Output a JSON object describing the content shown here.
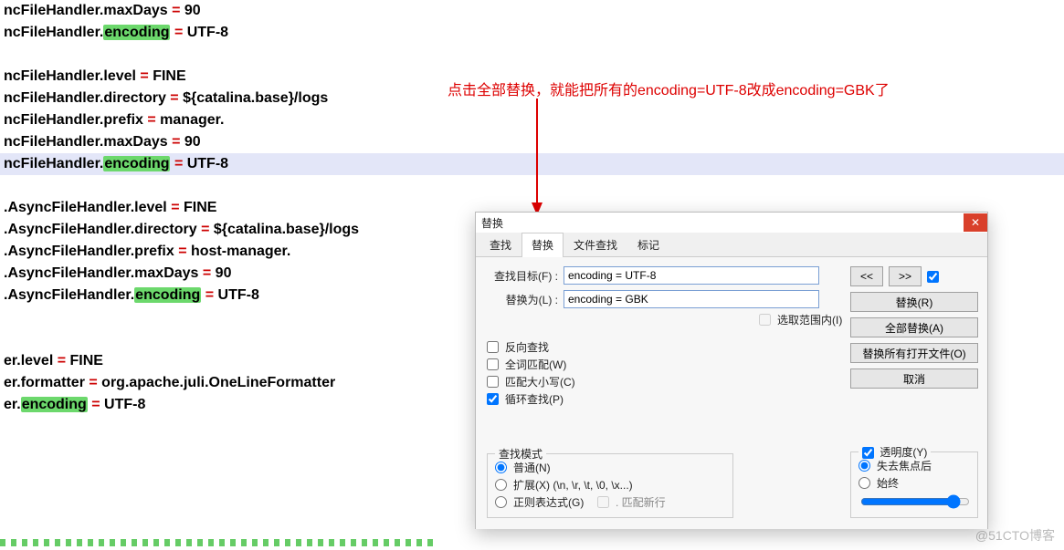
{
  "annotation": "点击全部替换，就能把所有的encoding=UTF-8改成encoding=GBK了",
  "watermark": "@51CTO博客",
  "editor": {
    "lines": [
      {
        "group": 0,
        "prefix": "ncFileHandler.",
        "key": "maxDays",
        "val": "90"
      },
      {
        "group": 0,
        "prefix": "ncFileHandler.",
        "key": "encoding",
        "val": "UTF-8",
        "hl": true
      },
      {
        "blank": true
      },
      {
        "group": 1,
        "prefix": "ncFileHandler.",
        "key": "level",
        "val": "FINE"
      },
      {
        "group": 1,
        "prefix": "ncFileHandler.",
        "key": "directory",
        "val": "${catalina.base}/logs"
      },
      {
        "group": 1,
        "prefix": "ncFileHandler.",
        "key": "prefix",
        "val": "manager."
      },
      {
        "group": 1,
        "prefix": "ncFileHandler.",
        "key": "maxDays",
        "val": "90"
      },
      {
        "group": 1,
        "prefix": "ncFileHandler.",
        "key": "encoding",
        "val": "UTF-8",
        "hl": true,
        "rowHL": true
      },
      {
        "blank": true
      },
      {
        "group": 2,
        "prefix": ".AsyncFileHandler.",
        "key": "level",
        "val": "FINE"
      },
      {
        "group": 2,
        "prefix": ".AsyncFileHandler.",
        "key": "directory",
        "val": "${catalina.base}/logs"
      },
      {
        "group": 2,
        "prefix": ".AsyncFileHandler.",
        "key": "prefix",
        "val": "host-manager."
      },
      {
        "group": 2,
        "prefix": ".AsyncFileHandler.",
        "key": "maxDays",
        "val": "90"
      },
      {
        "group": 2,
        "prefix": ".AsyncFileHandler.",
        "key": "encoding",
        "val": "UTF-8",
        "hl": true
      },
      {
        "blank": true
      },
      {
        "blank": true
      },
      {
        "group": 3,
        "prefix": "er.",
        "key": "level",
        "val": "FINE"
      },
      {
        "group": 3,
        "prefix": "er.",
        "key": "formatter",
        "val": "org.apache.juli.OneLineFormatter"
      },
      {
        "group": 3,
        "prefix": "er.",
        "key": "encoding",
        "val": "UTF-8",
        "hl": true
      }
    ]
  },
  "dialog": {
    "title": "替换",
    "tabs": [
      "查找",
      "替换",
      "文件查找",
      "标记"
    ],
    "active_tab": 1,
    "find_label": "查找目标(F) :",
    "replace_label": "替换为(L) :",
    "find_value": "encoding = UTF-8",
    "replace_value": "encoding = GBK",
    "in_selection": "选取范围内(I)",
    "back_search": "反向查找",
    "whole_word": "全词匹配(W)",
    "match_case": "匹配大小写(C)",
    "wrap_around": "循环查找(P)",
    "search_mode_title": "查找模式",
    "mode_normal": "普通(N)",
    "mode_extended": "扩展(X) (\\n, \\r, \\t, \\0, \\x...)",
    "mode_regex": "正则表达式(G)",
    "mode_regex_newline": ". 匹配新行",
    "btn_prev": "<<",
    "btn_next": ">>",
    "btn_replace": "替换(R)",
    "btn_replace_all": "全部替换(A)",
    "btn_replace_all_open": "替换所有打开文件(O)",
    "btn_cancel": "取消",
    "trans_title": "透明度(Y)",
    "trans_on_lose": "失去焦点后",
    "trans_always": "始终",
    "trans_checked": true,
    "wrap_checked": true
  }
}
